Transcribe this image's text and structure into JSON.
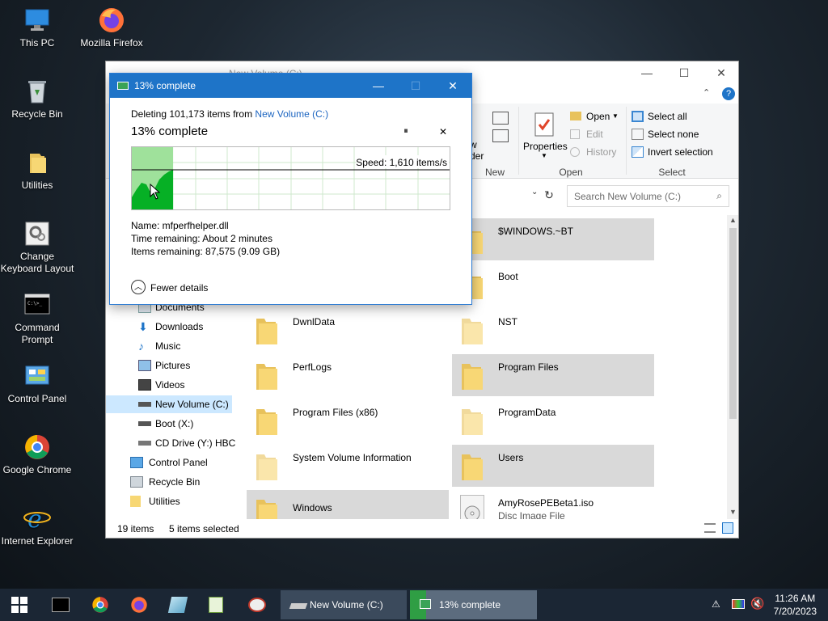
{
  "desktop": {
    "icons": [
      {
        "label": "This PC"
      },
      {
        "label": "Mozilla Firefox"
      },
      {
        "label": "Recycle Bin"
      },
      {
        "label": "Utilities"
      },
      {
        "label": "Change Keyboard Layout"
      },
      {
        "label": "Command Prompt"
      },
      {
        "label": "Control Panel"
      },
      {
        "label": "Google Chrome"
      },
      {
        "label": "Internet Explorer"
      }
    ]
  },
  "explorer": {
    "title": "New Volume (C:)",
    "ribbon": {
      "properties": "Properties",
      "open": "Open",
      "edit": "Edit",
      "history": "History",
      "select_all": "Select all",
      "select_none": "Select none",
      "invert_selection": "Invert selection",
      "new_partial_a": "w",
      "new_partial_b": "der",
      "groups": {
        "new": "New",
        "open": "Open",
        "select": "Select"
      }
    },
    "search_placeholder": "Search New Volume (C:)",
    "nav": [
      {
        "label": "Documents"
      },
      {
        "label": "Downloads"
      },
      {
        "label": "Music"
      },
      {
        "label": "Pictures"
      },
      {
        "label": "Videos"
      },
      {
        "label": "New Volume (C:)"
      },
      {
        "label": "Boot (X:)"
      },
      {
        "label": "CD Drive (Y:) HBC"
      },
      {
        "label": "Control Panel"
      },
      {
        "label": "Recycle Bin"
      },
      {
        "label": "Utilities"
      }
    ],
    "items": [
      {
        "name": "$WINDOWS.~BT"
      },
      {
        "name": "Boot"
      },
      {
        "name": "DwnlData"
      },
      {
        "name": "NST"
      },
      {
        "name": "PerfLogs"
      },
      {
        "name": "Program Files"
      },
      {
        "name": "Program Files (x86)"
      },
      {
        "name": "ProgramData"
      },
      {
        "name": "System Volume Information"
      },
      {
        "name": "Users"
      },
      {
        "name": "Windows"
      },
      {
        "name": "AmyRosePEBeta1.iso",
        "type": "Disc Image File"
      }
    ],
    "status": {
      "items": "19 items",
      "selected": "5 items selected"
    }
  },
  "dialog": {
    "title": "13% complete",
    "deleting_prefix": "Deleting 101,173 items from",
    "deleting_target": "New Volume (C:)",
    "heading": "13% complete",
    "progress": 0.13,
    "speed": "Speed: 1,610 items/s",
    "name_line": "Name:  mfperfhelper.dll",
    "time_line": "Time remaining:  About 2 minutes",
    "items_line": "Items remaining:  87,575 (9.09 GB)",
    "fewer_details": "Fewer details",
    "pause_glyph": "⏸",
    "close_glyph": "✕"
  },
  "taskbar": {
    "tasks": [
      {
        "label": "New Volume (C:)"
      },
      {
        "label": "13% complete"
      }
    ],
    "time": "11:26 AM",
    "date": "7/20/2023"
  },
  "colors": {
    "accent": "#1e74c8",
    "progress_green": "#06b025",
    "progress_fill": "#9fe19b",
    "selection": "#d9d9d9",
    "taskbar": "#1b2634"
  }
}
